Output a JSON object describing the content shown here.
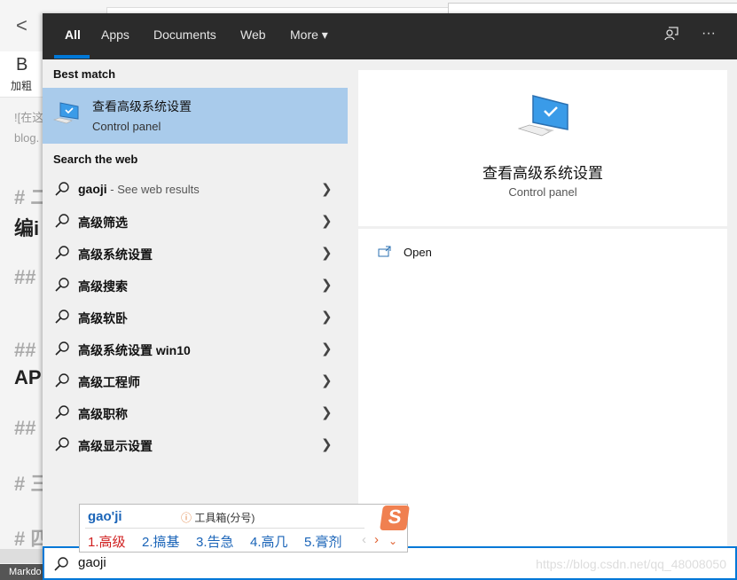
{
  "background": {
    "toolbar_bold": "B",
    "toolbar_bold_label": "加粗",
    "lines": [
      "![在这",
      "blog.",
      "# 二",
      "编i",
      "##",
      "##",
      "AP",
      "##",
      "# 三",
      "# 四"
    ],
    "statusbar": "Markdo"
  },
  "tabs": [
    {
      "label": "All",
      "active": true
    },
    {
      "label": "Apps"
    },
    {
      "label": "Documents"
    },
    {
      "label": "Web"
    },
    {
      "label": "More ▾"
    }
  ],
  "header_icons": {
    "feedback": "feedback-icon",
    "more": "···"
  },
  "best_match": {
    "heading": "Best match",
    "title": "查看高级系统设置",
    "subtitle": "Control panel"
  },
  "web": {
    "heading": "Search the web",
    "items": [
      {
        "label": "gaoji",
        "sub": " - See web results"
      },
      {
        "label": "高级筛选"
      },
      {
        "label": "高级系统设置"
      },
      {
        "label": "高级搜索"
      },
      {
        "label": "高级软卧"
      },
      {
        "label": "高级系统设置 win10"
      },
      {
        "label": "高级工程师"
      },
      {
        "label": "高级职称"
      },
      {
        "label": "高级显示设置"
      }
    ]
  },
  "preview": {
    "title": "查看高级系统设置",
    "subtitle": "Control panel",
    "action_open": "Open"
  },
  "search": {
    "value": "gaoji",
    "watermark": "https://blog.csdn.net/qq_48008050"
  },
  "ime": {
    "pinyin": "gao'ji",
    "toolbox": "工具箱(分号)",
    "candidates": [
      "1.高级",
      "2.搞基",
      "3.告急",
      "4.高几",
      "5.膏剂"
    ],
    "logo": "S"
  },
  "colors": {
    "accent": "#0078d7",
    "selected": "#a9cbeb",
    "header": "#2b2b2b"
  }
}
